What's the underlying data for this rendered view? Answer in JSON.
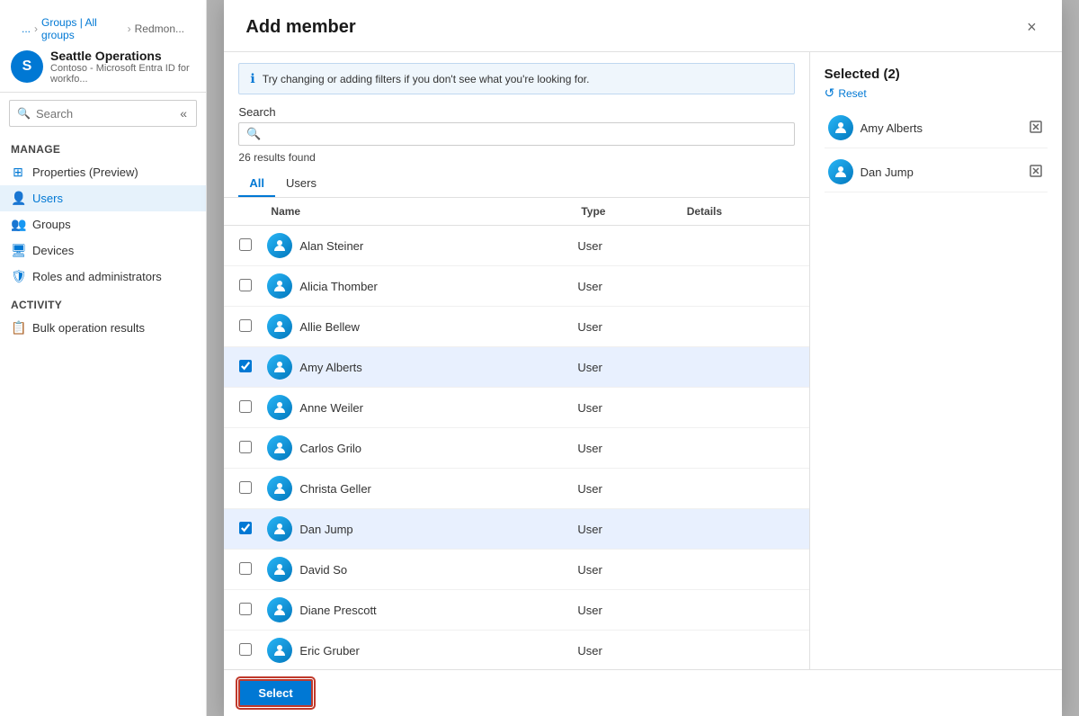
{
  "sidebar": {
    "org_avatar": "S",
    "org_name": "Seattle Operations",
    "org_sub": "Contoso - Microsoft Entra ID for workfo...",
    "search_placeholder": "Search",
    "collapse_label": "«",
    "breadcrumb": [
      {
        "label": "...",
        "href": "#"
      },
      {
        "label": "Groups | All groups",
        "href": "#"
      },
      {
        "label": "Redmon...",
        "href": "#"
      }
    ],
    "sections": [
      {
        "label": "Manage",
        "items": [
          {
            "label": "Properties (Preview)",
            "icon": "⊞",
            "active": false
          },
          {
            "label": "Users",
            "icon": "👤",
            "active": true
          },
          {
            "label": "Groups",
            "icon": "👥",
            "active": false
          },
          {
            "label": "Devices",
            "icon": "🖥",
            "active": false
          },
          {
            "label": "Roles and administrators",
            "icon": "🛡",
            "active": false
          }
        ]
      },
      {
        "label": "Activity",
        "items": [
          {
            "label": "Bulk operation results",
            "icon": "📋",
            "active": false
          }
        ]
      }
    ]
  },
  "modal": {
    "title": "Add member",
    "close_label": "×",
    "info_banner": "Try changing or adding filters if you don't see what you're looking for.",
    "search_label": "Search",
    "search_placeholder": "",
    "results_count": "26 results found",
    "tabs": [
      {
        "label": "All",
        "active": true
      },
      {
        "label": "Users",
        "active": false
      }
    ],
    "table_headers": [
      "",
      "Name",
      "Type",
      "Details"
    ],
    "rows": [
      {
        "name": "Alan Steiner",
        "type": "User",
        "selected": false
      },
      {
        "name": "Alicia Thomber",
        "type": "User",
        "selected": false
      },
      {
        "name": "Allie Bellew",
        "type": "User",
        "selected": false
      },
      {
        "name": "Amy Alberts",
        "type": "User",
        "selected": true
      },
      {
        "name": "Anne Weiler",
        "type": "User",
        "selected": false
      },
      {
        "name": "Carlos Grilo",
        "type": "User",
        "selected": false
      },
      {
        "name": "Christa Geller",
        "type": "User",
        "selected": false
      },
      {
        "name": "Dan Jump",
        "type": "User",
        "selected": true
      },
      {
        "name": "David So",
        "type": "User",
        "selected": false
      },
      {
        "name": "Diane Prescott",
        "type": "User",
        "selected": false
      },
      {
        "name": "Eric Gruber",
        "type": "User",
        "selected": false
      }
    ],
    "select_button_label": "Select",
    "selected_panel": {
      "title": "Selected (2)",
      "reset_label": "Reset",
      "items": [
        {
          "name": "Amy Alberts"
        },
        {
          "name": "Dan Jump"
        }
      ]
    }
  }
}
